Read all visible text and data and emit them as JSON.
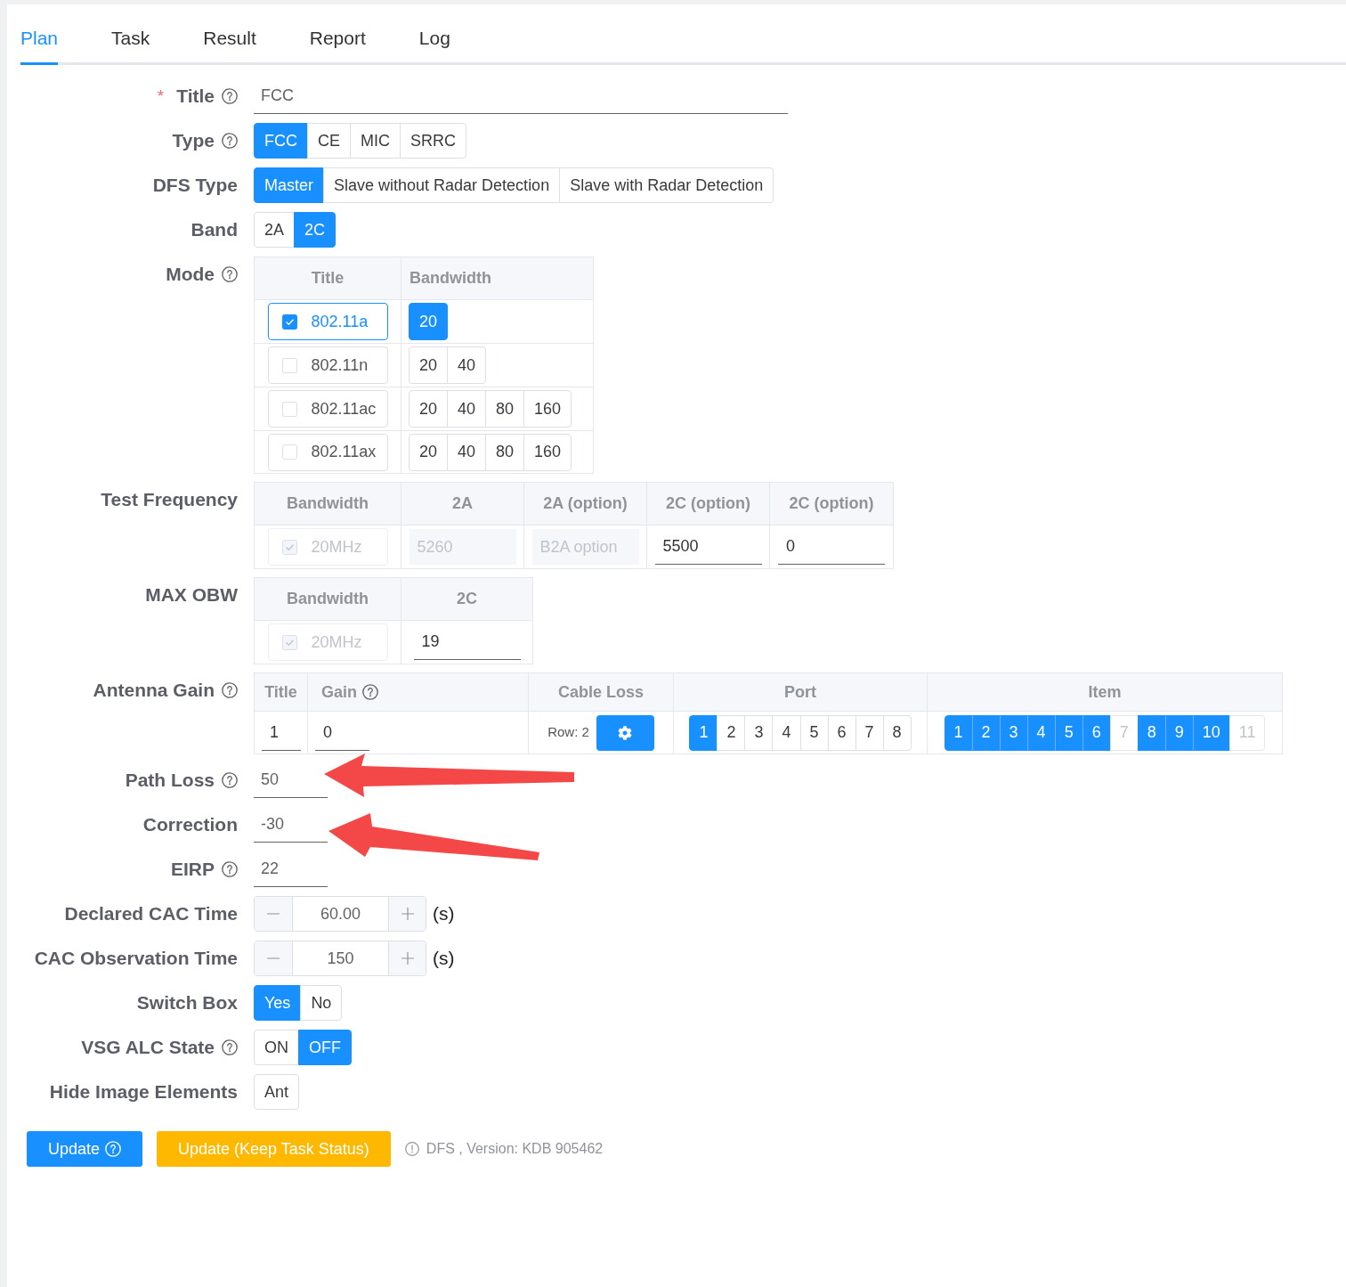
{
  "tabs": [
    {
      "label": "Plan",
      "selected": true
    },
    {
      "label": "Task",
      "selected": false
    },
    {
      "label": "Result",
      "selected": false
    },
    {
      "label": "Report",
      "selected": false
    },
    {
      "label": "Log",
      "selected": false
    }
  ],
  "form": [
    {
      "kind": "title",
      "label": "Title",
      "required_mark": "*",
      "help": true,
      "value": "FCC"
    },
    {
      "kind": "segmented",
      "label": "Type",
      "help": true,
      "options": [
        {
          "label": "FCC",
          "selected": true
        },
        {
          "label": "CE",
          "selected": false
        },
        {
          "label": "MIC",
          "selected": false
        },
        {
          "label": "SRRC",
          "selected": false
        }
      ]
    },
    {
      "kind": "segmented",
      "label": "DFS Type",
      "options": [
        {
          "label": "Master",
          "selected": true
        },
        {
          "label": "Slave without Radar Detection",
          "selected": false
        },
        {
          "label": "Slave with Radar Detection",
          "selected": false
        }
      ]
    },
    {
      "kind": "segmented",
      "label": "Band",
      "options": [
        {
          "label": "2A",
          "selected": false
        },
        {
          "label": "2C",
          "selected": true
        }
      ]
    },
    {
      "kind": "modes",
      "label": "Mode",
      "help": true,
      "columns": [
        "Title",
        "Bandwidth"
      ],
      "rows": [
        {
          "title": "802.11a",
          "checked": true,
          "bandwidths": [
            {
              "label": "20",
              "selected": true
            }
          ]
        },
        {
          "title": "802.11n",
          "checked": false,
          "bandwidths": [
            {
              "label": "20",
              "selected": false
            },
            {
              "label": "40",
              "selected": false
            }
          ]
        },
        {
          "title": "802.11ac",
          "checked": false,
          "bandwidths": [
            {
              "label": "20",
              "selected": false
            },
            {
              "label": "40",
              "selected": false
            },
            {
              "label": "80",
              "selected": false
            },
            {
              "label": "160",
              "selected": false
            }
          ]
        },
        {
          "title": "802.11ax",
          "checked": false,
          "bandwidths": [
            {
              "label": "20",
              "selected": false
            },
            {
              "label": "40",
              "selected": false
            },
            {
              "label": "80",
              "selected": false
            },
            {
              "label": "160",
              "selected": false
            }
          ]
        }
      ]
    },
    {
      "kind": "grid",
      "label": "Test Frequency",
      "columns": [
        "Bandwidth",
        "2A",
        "2A (option)",
        "2C (option)",
        "2C (option)"
      ],
      "rows": [
        {
          "cells": [
            {
              "kind": "checkbox",
              "label": "20MHz",
              "checked": true,
              "disabled": true
            },
            {
              "kind": "input",
              "value": "5260",
              "disabled": true
            },
            {
              "kind": "input",
              "placeholder": "B2A option",
              "disabled": true
            },
            {
              "kind": "input",
              "value": "5500",
              "disabled": false
            },
            {
              "kind": "input",
              "value": "0",
              "disabled": false
            }
          ]
        }
      ]
    },
    {
      "kind": "grid",
      "label": "MAX OBW",
      "columns": [
        "Bandwidth",
        "2C"
      ],
      "rows": [
        {
          "cells": [
            {
              "kind": "checkbox",
              "label": "20MHz",
              "checked": true,
              "disabled": true
            },
            {
              "kind": "input",
              "value": "19",
              "disabled": false
            }
          ]
        }
      ]
    },
    {
      "kind": "antenna",
      "label": "Antenna Gain",
      "help": true,
      "columns": [
        {
          "label": "Title"
        },
        {
          "label": "Gain",
          "help": true
        },
        {
          "label": "Cable Loss"
        },
        {
          "label": "Port"
        },
        {
          "label": "Item"
        }
      ],
      "rows": [
        {
          "title": "1",
          "gain": "0",
          "cable_loss": "Row: 2",
          "ports": [
            {
              "label": "1",
              "selected": true
            },
            {
              "label": "2",
              "selected": false
            },
            {
              "label": "3",
              "selected": false
            },
            {
              "label": "4",
              "selected": false
            },
            {
              "label": "5",
              "selected": false
            },
            {
              "label": "6",
              "selected": false
            },
            {
              "label": "7",
              "selected": false
            },
            {
              "label": "8",
              "selected": false
            }
          ],
          "items": [
            {
              "label": "1",
              "selected": true,
              "disabled": false
            },
            {
              "label": "2",
              "selected": true,
              "disabled": false
            },
            {
              "label": "3",
              "selected": true,
              "disabled": false
            },
            {
              "label": "4",
              "selected": true,
              "disabled": false
            },
            {
              "label": "5",
              "selected": true,
              "disabled": false
            },
            {
              "label": "6",
              "selected": true,
              "disabled": false
            },
            {
              "label": "7",
              "selected": false,
              "disabled": true
            },
            {
              "label": "8",
              "selected": true,
              "disabled": false
            },
            {
              "label": "9",
              "selected": true,
              "disabled": false
            },
            {
              "label": "10",
              "selected": true,
              "disabled": false
            },
            {
              "label": "11",
              "selected": false,
              "disabled": true
            }
          ]
        }
      ]
    },
    {
      "kind": "input",
      "label": "Path Loss",
      "help": true,
      "value": "50"
    },
    {
      "kind": "input",
      "label": "Correction",
      "value": "-30"
    },
    {
      "kind": "input",
      "label": "EIRP",
      "help": true,
      "value": "22"
    },
    {
      "kind": "stepper",
      "label": "Declared CAC Time",
      "value": "60.00",
      "unit": "(s)"
    },
    {
      "kind": "stepper",
      "label": "CAC Observation Time",
      "value": "150",
      "unit": "(s)"
    },
    {
      "kind": "segmented",
      "label": "Switch Box",
      "options": [
        {
          "label": "Yes",
          "selected": true
        },
        {
          "label": "No",
          "selected": false
        }
      ]
    },
    {
      "kind": "segmented",
      "label": "VSG ALC State",
      "help": true,
      "options": [
        {
          "label": "ON",
          "selected": false
        },
        {
          "label": "OFF",
          "selected": true
        }
      ]
    },
    {
      "kind": "segmented",
      "label": "Hide Image Elements",
      "options": [
        {
          "label": "Ant",
          "selected": false
        }
      ]
    }
  ],
  "actions": [
    {
      "kind": "primary",
      "label": "Update",
      "help": true
    },
    {
      "kind": "warning",
      "label": "Update (Keep Task Status)"
    }
  ],
  "note": "DFS , Version: KDB 905462"
}
